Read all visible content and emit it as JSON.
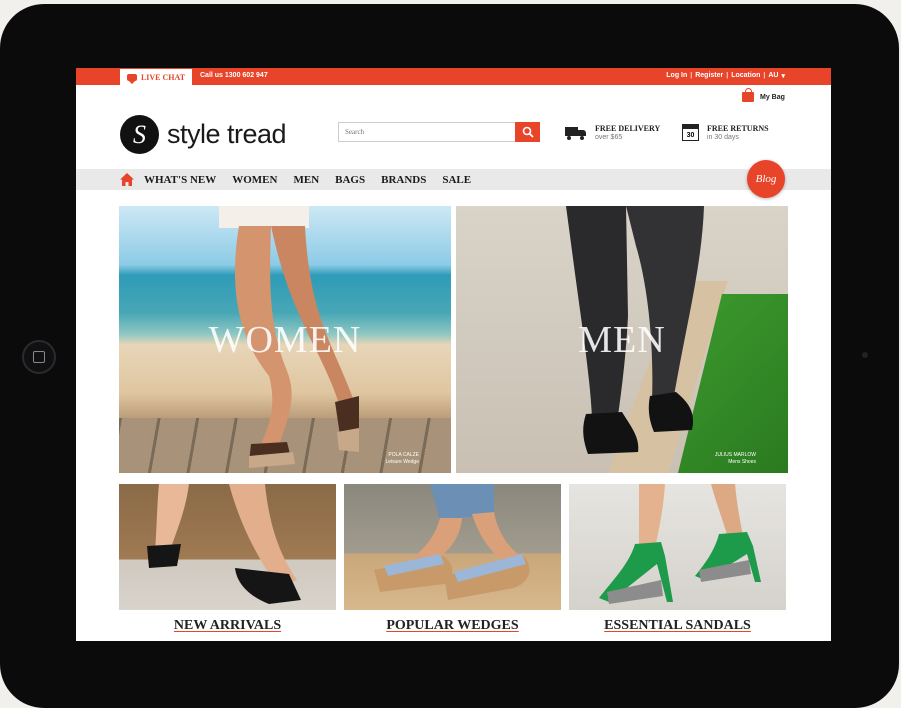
{
  "topbar": {
    "live_chat": "LIVE CHAT",
    "call_us": "Call us 1300 602 947",
    "login": "Log In",
    "register": "Register",
    "location": "Location",
    "location_value": "AU"
  },
  "header": {
    "bag": "My Bag",
    "logo_mark": "S",
    "logo_text": "style tread",
    "search_placeholder": "Search",
    "free_delivery": "FREE DELIVERY",
    "free_delivery_sub": "over $65",
    "free_returns": "FREE RETURNS",
    "free_returns_sub": "in 30 days",
    "calendar_day": "30"
  },
  "nav": {
    "items": [
      "WHAT'S NEW",
      "WOMEN",
      "MEN",
      "BAGS",
      "BRANDS",
      "SALE"
    ],
    "blog": "Blog"
  },
  "hero": {
    "women_label": "WOMEN",
    "women_credit_1": "POLA CALZE",
    "women_credit_2": "Leisure Wedge",
    "men_label": "MEN",
    "men_credit_1": "JULIUS MARLOW",
    "men_credit_2": "Mens Shoes"
  },
  "tiles": {
    "new_arrivals": "NEW ARRIVALS",
    "popular_wedges": "POPULAR WEDGES",
    "essential_sandals": "ESSENTIAL SANDALS"
  },
  "colors": {
    "accent": "#e8442a",
    "nav_bg": "#e9e9e9"
  }
}
